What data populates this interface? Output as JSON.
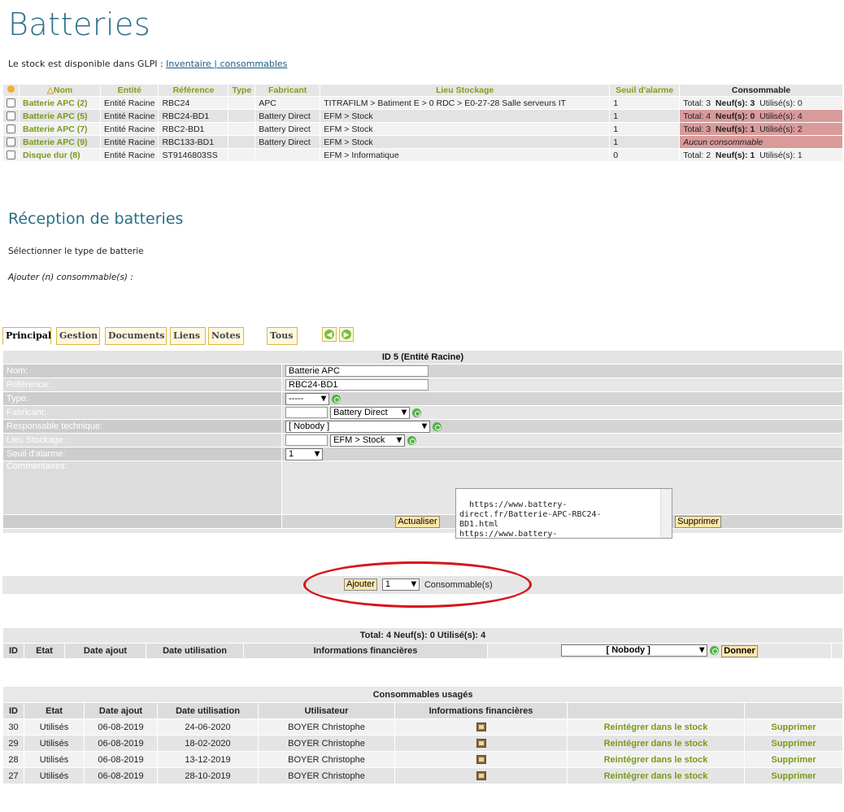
{
  "page": {
    "title": "Batteries",
    "intro_text": "Le stock est disponible dans GLPI : ",
    "intro_link": "Inventaire |  consommables"
  },
  "stock_table": {
    "headers": [
      "Nom",
      "Entité",
      "Référence",
      "Type",
      "Fabricant",
      "Lieu Stockage",
      "Seuil d'alarme",
      "Consommable"
    ],
    "rows": [
      {
        "nom": "Batterie APC (2)",
        "entite": "Entité Racine",
        "reference": "RBC24",
        "type": "",
        "fabricant": "APC",
        "lieu": "TITRAFILM > Batiment E > 0 RDC > E0-27-28 Salle serveurs IT",
        "seuil": "1",
        "total": "Total: 3",
        "neufs_label": "Neuf(s): 3",
        "utilises": "Utilisé(s): 0",
        "alert": false
      },
      {
        "nom": "Batterie APC (5)",
        "entite": "Entité Racine",
        "reference": "RBC24-BD1",
        "type": "",
        "fabricant": "Battery Direct",
        "lieu": "EFM > Stock",
        "seuil": "1",
        "total": "Total: 4",
        "neufs_label": "Neuf(s): 0",
        "utilises": "Utilisé(s): 4",
        "alert": true
      },
      {
        "nom": "Batterie APC (7)",
        "entite": "Entité Racine",
        "reference": "RBC2-BD1",
        "type": "",
        "fabricant": "Battery Direct",
        "lieu": "EFM > Stock",
        "seuil": "1",
        "total": "Total: 3",
        "neufs_label": "Neuf(s): 1",
        "utilises": "Utilisé(s): 2",
        "alert": true
      },
      {
        "nom": "Batterie APC (9)",
        "entite": "Entité Racine",
        "reference": "RBC133-BD1",
        "type": "",
        "fabricant": "Battery Direct",
        "lieu": "EFM > Stock",
        "seuil": "1",
        "none_text": "Aucun consommable",
        "alert": true
      },
      {
        "nom": "Disque dur (8)",
        "entite": "Entité Racine",
        "reference": "ST9146803SS",
        "type": "",
        "fabricant": "",
        "lieu": "EFM > Informatique",
        "seuil": "0",
        "total": "Total: 2",
        "neufs_label": "Neuf(s): 1",
        "utilises": "Utilisé(s): 1",
        "alert": false
      }
    ]
  },
  "reception": {
    "title": "Réception de batteries",
    "select_type": "Sélectionner le type de batterie",
    "add_n": "Ajouter (n) consommable(s) :"
  },
  "tabs": [
    "Principal",
    "Gestion",
    "Documents",
    "Liens",
    "Notes",
    "Tous"
  ],
  "form": {
    "header": "ID 5 (Entité Racine)",
    "nom_label": "Nom:",
    "nom_value": "Batterie APC",
    "ref_label": "Référence:",
    "ref_value": "RBC24-BD1",
    "type_label": "Type:",
    "type_value": "-----",
    "fabricant_label": "Fabricant:",
    "fabricant_value": "Battery Direct",
    "resp_label": "Responsable technique:",
    "resp_value": "[ Nobody ]",
    "lieu_label": "Lieu Stockage:",
    "lieu_value": "EFM > Stock",
    "seuil_label": "Seuil d'alarme:",
    "seuil_value": "1",
    "comment_label": "Commentaires:",
    "comment_value": "https://www.battery-\ndirect.fr/Batterie-APC-RBC24-\nBD1.html\nhttps://www.battery-",
    "update_button": "Actualiser",
    "delete_button": "Supprimer"
  },
  "add_section": {
    "button": "Ajouter",
    "qty": "1",
    "suffix": "Consommable(s)"
  },
  "consumables": {
    "total_line": "Total: 4   Neuf(s): 0   Utilisé(s): 4",
    "headers": [
      "ID",
      "Etat",
      "Date ajout",
      "Date utilisation",
      "Informations financières"
    ],
    "give_select": "[ Nobody ]",
    "give_button": "Donner"
  },
  "used": {
    "caption": "Consommables usagés",
    "headers": [
      "ID",
      "Etat",
      "Date ajout",
      "Date utilisation",
      "Utilisateur",
      "Informations financières",
      "",
      ""
    ],
    "rows": [
      {
        "id": "30",
        "etat": "Utilisés",
        "ajout": "06-08-2019",
        "utilisation": "24-06-2020",
        "user": "BOYER Christophe",
        "reint": "Reintégrer dans le stock",
        "del": "Supprimer"
      },
      {
        "id": "29",
        "etat": "Utilisés",
        "ajout": "06-08-2019",
        "utilisation": "18-02-2020",
        "user": "BOYER Christophe",
        "reint": "Reintégrer dans le stock",
        "del": "Supprimer"
      },
      {
        "id": "28",
        "etat": "Utilisés",
        "ajout": "06-08-2019",
        "utilisation": "13-12-2019",
        "user": "BOYER Christophe",
        "reint": "Reintégrer dans le stock",
        "del": "Supprimer"
      },
      {
        "id": "27",
        "etat": "Utilisés",
        "ajout": "06-08-2019",
        "utilisation": "28-10-2019",
        "user": "BOYER Christophe",
        "reint": "Reintégrer dans le stock",
        "del": "Supprimer"
      }
    ]
  },
  "colors": {
    "title": "#2b6f86",
    "accent_green": "#7a9a1a",
    "alert_red": "#d99a9a",
    "highlight_ellipse": "#d6141a",
    "button_bg": "#fde7a9"
  }
}
